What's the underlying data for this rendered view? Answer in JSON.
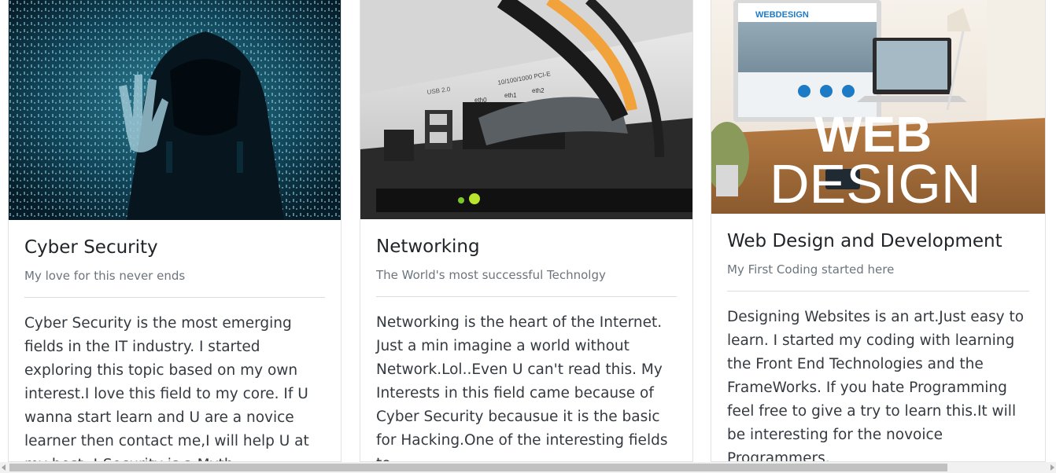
{
  "cards": [
    {
      "image_name": "hooded-hacker-binary-code-image",
      "title": "Cyber Security",
      "subtitle": "My love for this never ends",
      "text": "Cyber Security is the most emerging fields in the IT industry. I started exploring this topic based on my own interest.I love this field to my core. If U wanna start learn and U are a novice learner then contact me,I will help U at my best..! Security is a Myth"
    },
    {
      "image_name": "network-switch-ethernet-cables-image",
      "title": "Networking",
      "subtitle": "The World's most successful Technolgy",
      "text": "Networking is the heart of the Internet. Just a min imagine a world without Network.Lol..Even U can't read this. My Interests in this field came because of Cyber Security becausue it is the basic for Hacking.One of the interesting fields to"
    },
    {
      "image_name": "web-design-devices-desk-image",
      "title": "Web Design and Development",
      "subtitle": "My First Coding started here",
      "text": "Designing Websites is an art.Just easy to learn. I started my coding with learning the Front End Technologies and the FrameWorks. If you hate Programming feel free to give a try to learn this.It will be interesting for the novoice Programmers."
    }
  ],
  "image_text": {
    "port_speed": "10/100/1000 PCI-E",
    "port_labels": [
      "eth0",
      "eth1",
      "eth2"
    ],
    "usb_label": "USB 2.0",
    "web_design_big_1": "WEB",
    "web_design_big_2": "DESIGN",
    "monitor_logo": "WEBDESIGN"
  }
}
